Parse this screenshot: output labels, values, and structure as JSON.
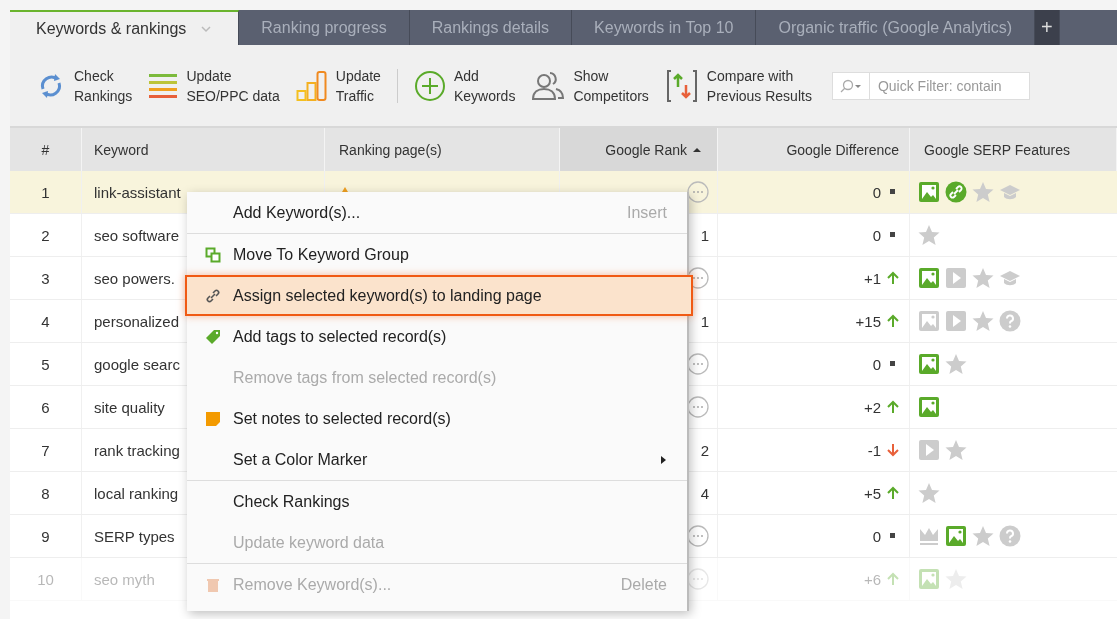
{
  "tabs": [
    {
      "label": "Keywords & rankings",
      "selected": true,
      "dropdown": true
    },
    {
      "label": "Ranking progress",
      "selected": false
    },
    {
      "label": "Rankings details",
      "selected": false
    },
    {
      "label": "Keywords in Top 10",
      "selected": false
    },
    {
      "label": "Organic traffic (Google Analytics)",
      "selected": false
    }
  ],
  "add_tab": "+",
  "toolbar": [
    {
      "kind": "refresh",
      "lines": [
        "Check",
        "Rankings"
      ]
    },
    {
      "kind": "bars",
      "lines": [
        "Update",
        "SEO/PPC data"
      ]
    },
    {
      "kind": "traffic",
      "lines": [
        "Update",
        "Traffic"
      ]
    },
    {
      "kind": "add",
      "lines": [
        "Add",
        "Keywords"
      ]
    },
    {
      "kind": "people",
      "lines": [
        "Show",
        "Competitors"
      ]
    },
    {
      "kind": "compare",
      "lines": [
        "Compare with",
        "Previous Results"
      ]
    }
  ],
  "quick_filter": {
    "placeholder": "Quick Filter: contain"
  },
  "table": {
    "columns": [
      {
        "label": "#"
      },
      {
        "label": "Keyword"
      },
      {
        "label": "Ranking page(s)"
      },
      {
        "label": "Google Rank",
        "sorted": true
      },
      {
        "label": "Google Difference"
      },
      {
        "label": "Google SERP Features"
      }
    ],
    "rows": [
      {
        "num": "1",
        "keyword": "link-assistant",
        "rank": "",
        "difference": "0",
        "kind": "flat",
        "selected": true,
        "dimmed": false,
        "has_page": true,
        "features": [
          {
            "kind": "image",
            "on": true
          },
          {
            "kind": "link",
            "on": true
          },
          {
            "kind": "star",
            "on": false
          },
          {
            "kind": "cap",
            "on": false
          }
        ]
      },
      {
        "num": "2",
        "keyword": "seo software",
        "rank": "1",
        "difference": "0",
        "kind": "flat",
        "selected": false,
        "dimmed": false,
        "features": [
          {
            "kind": "star",
            "on": false
          }
        ]
      },
      {
        "num": "3",
        "keyword": "seo powers.",
        "rank": "",
        "difference": "+1",
        "kind": "up",
        "selected": false,
        "dimmed": false,
        "features": [
          {
            "kind": "image",
            "on": true
          },
          {
            "kind": "video",
            "on": false
          },
          {
            "kind": "star",
            "on": false
          },
          {
            "kind": "cap",
            "on": false
          }
        ]
      },
      {
        "num": "4",
        "keyword": "personalized",
        "rank": "1",
        "difference": "+15",
        "kind": "up",
        "selected": false,
        "dimmed": false,
        "features": [
          {
            "kind": "image",
            "on": false
          },
          {
            "kind": "video",
            "on": false
          },
          {
            "kind": "star",
            "on": false
          },
          {
            "kind": "question",
            "on": false
          }
        ]
      },
      {
        "num": "5",
        "keyword": "google searc",
        "rank": "",
        "difference": "0",
        "kind": "flat",
        "selected": false,
        "dimmed": false,
        "features": [
          {
            "kind": "image",
            "on": true
          },
          {
            "kind": "star",
            "on": false
          }
        ]
      },
      {
        "num": "6",
        "keyword": "site quality",
        "rank": "",
        "difference": "+2",
        "kind": "up",
        "selected": false,
        "dimmed": false,
        "features": [
          {
            "kind": "image",
            "on": true
          }
        ]
      },
      {
        "num": "7",
        "keyword": "rank tracking",
        "rank": "2",
        "difference": "-1",
        "kind": "down",
        "selected": false,
        "dimmed": false,
        "features": [
          {
            "kind": "video",
            "on": false
          },
          {
            "kind": "star",
            "on": false
          }
        ]
      },
      {
        "num": "8",
        "keyword": "local ranking",
        "rank": "4",
        "difference": "+5",
        "kind": "up",
        "selected": false,
        "dimmed": false,
        "features": [
          {
            "kind": "star",
            "on": false
          }
        ]
      },
      {
        "num": "9",
        "keyword": "SERP types",
        "rank": "",
        "difference": "0",
        "kind": "flat",
        "selected": false,
        "dimmed": false,
        "features": [
          {
            "kind": "crown",
            "on": false
          },
          {
            "kind": "image",
            "on": true
          },
          {
            "kind": "star",
            "on": false
          },
          {
            "kind": "question",
            "on": false
          }
        ]
      },
      {
        "num": "10",
        "keyword": "seo myth",
        "rank": "",
        "difference": "+6",
        "kind": "up",
        "selected": false,
        "dimmed": true,
        "features": [
          {
            "kind": "image",
            "on": true
          },
          {
            "kind": "star",
            "on": false
          }
        ]
      }
    ]
  },
  "context_menu": [
    {
      "label": "Add Keyword(s)...",
      "shortcut": "Insert",
      "kind": "plain",
      "disabled": false,
      "selected": false
    },
    {
      "label": "Move To Keyword Group",
      "kind": "group",
      "disabled": false,
      "selected": false,
      "separator": true
    },
    {
      "label": "Assign selected keyword(s) to landing page",
      "kind": "link",
      "disabled": false,
      "selected": true
    },
    {
      "label": "Add tags to selected record(s)",
      "kind": "tag",
      "disabled": false,
      "selected": false
    },
    {
      "label": "Remove tags from selected record(s)",
      "kind": "plain",
      "disabled": true,
      "selected": false
    },
    {
      "label": "Set notes to selected record(s)",
      "kind": "note",
      "disabled": false,
      "selected": false
    },
    {
      "label": "Set a Color Marker",
      "kind": "plain",
      "disabled": false,
      "selected": false,
      "submenu": true
    },
    {
      "label": "Check Rankings",
      "kind": "plain",
      "disabled": false,
      "selected": false,
      "separator": true
    },
    {
      "label": "Update keyword data",
      "kind": "plain",
      "disabled": true,
      "selected": false
    },
    {
      "label": "Remove Keyword(s)...",
      "shortcut": "Delete",
      "kind": "trash",
      "disabled": true,
      "selected": false,
      "separator": true
    }
  ]
}
